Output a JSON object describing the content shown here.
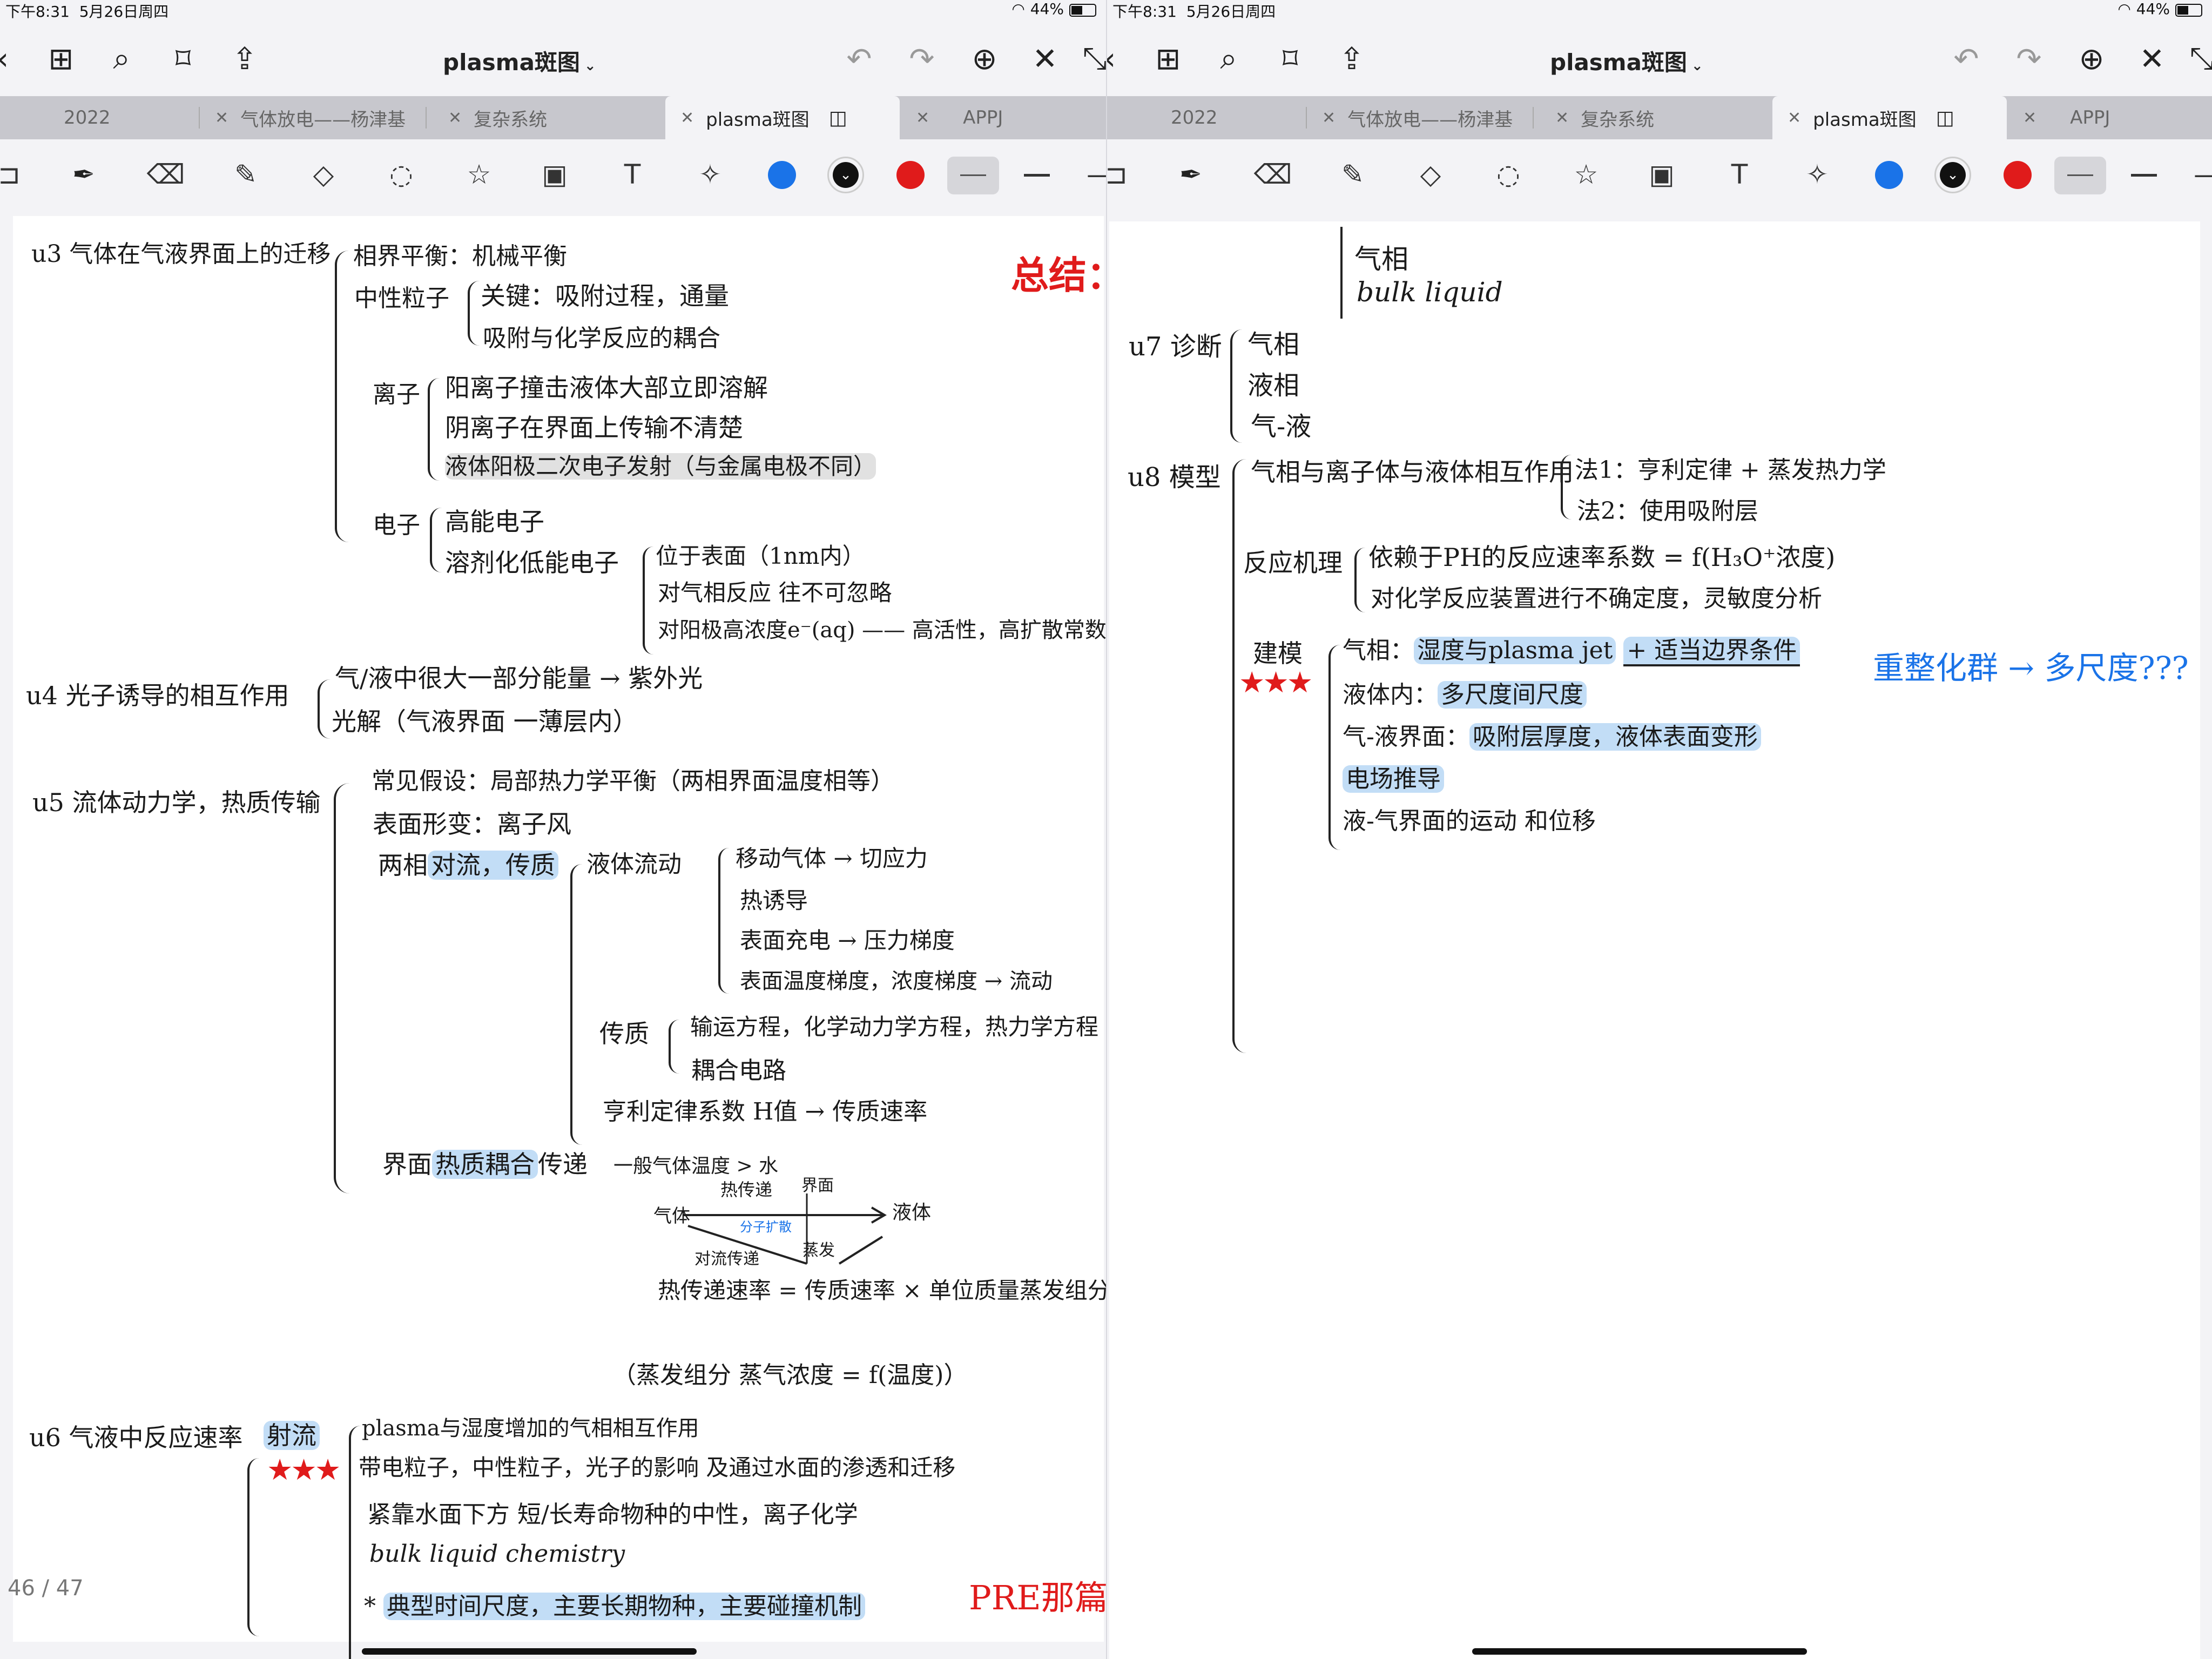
{
  "status": {
    "left": {
      "time": "下午8:31",
      "date": "5月26日周四",
      "battery": "44%"
    },
    "right": {
      "time": "下午8:31",
      "date": "5月26日周四",
      "battery": "44%"
    }
  },
  "doc_title": "plasma斑图",
  "tabs": [
    "2022",
    "气体放电——杨津基",
    "复杂系统",
    "plasma斑图",
    "APPJ"
  ],
  "page_indicator": "46 / 47",
  "colors": [
    "#1a73e8",
    "#111111",
    "#e01b1b"
  ],
  "left": {
    "u3_title": "u3 气体在气液界面上的迁移",
    "u3_a": "相界平衡：机械平衡",
    "u3_neutral": "中性粒子",
    "u3_n1": "关键：吸附过程，通量",
    "u3_n2": "吸附与化学反应的耦合",
    "u3_ion": "离子",
    "u3_i1": "阳离子撞击液体大部立即溶解",
    "u3_i2": "阴离子在界面上传输不清楚",
    "u3_i3": "液体阳极二次电子发射（与金属电极不同）",
    "u3_e": "电子",
    "u3_e1": "高能电子",
    "u3_e2": "溶剂化低能电子",
    "u3_e3": "位于表面（1nm内）",
    "u3_e4": "对气相反应 往不可忽略",
    "u3_e5": "对阳极高浓度e⁻(aq) —— 高活性，高扩散常数",
    "summary": "总结：",
    "u4_title": "u4 光子诱导的相互作用",
    "u4_1": "气/液中很大一部分能量 → 紫外光",
    "u4_2": "光解（气液界面 一薄层内）",
    "u5_title": "u5 流体动力学，热质传输",
    "u5_1": "常见假设：局部热力学平衡（两相界面温度相等）",
    "u5_2": "表面形变：离子风",
    "u5_3a": "两相",
    "u5_3b": "对流，传质",
    "u5_flow": "液体流动",
    "u5_f1": "移动气体 → 切应力",
    "u5_f2": "热诱导",
    "u5_f3": "表面充电 → 压力梯度",
    "u5_f4": "表面温度梯度，浓度梯度 → 流动",
    "u5_mass": "传质",
    "u5_m1": "输运方程，化学动力学方程，热力学方程",
    "u5_m2": "耦合电路",
    "u5_law": "亨利定律系数 H值 → 传质速率",
    "u5_iface_a": "界面",
    "u5_iface_b": "热质耦合",
    "u5_iface_c": "传递",
    "u5_iface_note": "一般气体温度 > 水",
    "d_heat": "热传递",
    "d_iface": "界面",
    "d_gas": "气体",
    "d_liquid": "液体",
    "d_evap": "蒸发",
    "d_cond": "对流传递",
    "d_small": "分子扩散",
    "u5_eq": "热传递速率 = 传质速率 × 单位质量蒸发组分的蒸发热",
    "u5_eq2": "（蒸发组分 蒸气浓度 = f(温度)）",
    "u6_title": "u6 气液中反应速率",
    "u6_tag": "射流",
    "u6_1": "plasma与湿度增加的气相相互作用",
    "u6_2": "带电粒子，中性粒子，光子的影响 及通过水面的渗透和迁移",
    "u6_3": "紧靠水面下方 短/长寿命物种的中性，离子化学",
    "u6_4": "bulk liquid chemistry",
    "u6_5": "典型时间尺度，主要长期物种，主要碰撞机制",
    "pre": "PRE那篇",
    "stars": "★★★"
  },
  "right": {
    "top_1": "气相",
    "top_2": "bulk liquid",
    "u7_title": "u7 诊断",
    "u7_1": "气相",
    "u7_2": "液相",
    "u7_3": "气-液",
    "u8_title": "u8 模型",
    "u8_a": "气相与离子体与液体相互作用",
    "u8_a1": "法1：亨利定律 + 蒸发热力学",
    "u8_a2": "法2：使用吸附层",
    "u8_b": "反应机理",
    "u8_b1": "依赖于PH的反应速率系数 = f(H₃O⁺浓度)",
    "u8_b2": "对化学反应装置进行不确定度，灵敏度分析",
    "u8_c": "建模",
    "u8_c1a": "气相：",
    "u8_c1b": "湿度与plasma jet",
    "u8_c1c": "+ 适当边界条件",
    "u8_c2a": "液体内：",
    "u8_c2b": "多尺度间尺度",
    "u8_c3a": "气-液界面：",
    "u8_c3b": "吸附层厚度，液体表面变形",
    "u8_c4": "电场推导",
    "u8_c5": "液-气界面的运动 和位移",
    "blue_note": "重整化群 → 多尺度???",
    "stars": "★★★"
  }
}
